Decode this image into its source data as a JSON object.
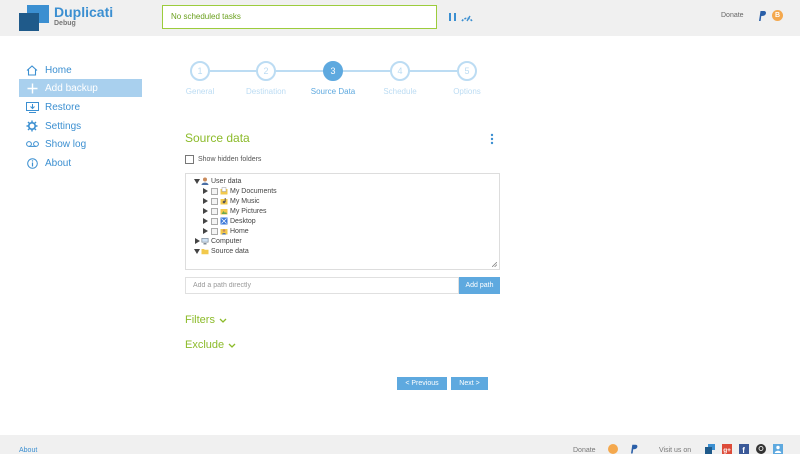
{
  "header": {
    "app_title": "Duplicati",
    "app_subtitle": "Debug",
    "status": "No scheduled tasks",
    "donate_label": "Donate"
  },
  "sidebar": {
    "items": [
      {
        "label": "Home",
        "icon": "home-icon"
      },
      {
        "label": "Add backup",
        "icon": "plus-icon",
        "active": true
      },
      {
        "label": "Restore",
        "icon": "restore-icon"
      },
      {
        "label": "Settings",
        "icon": "gear-icon"
      },
      {
        "label": "Show log",
        "icon": "log-icon"
      },
      {
        "label": "About",
        "icon": "info-icon"
      }
    ]
  },
  "wizard": {
    "steps": [
      {
        "number": "1",
        "label": "General"
      },
      {
        "number": "2",
        "label": "Destination"
      },
      {
        "number": "3",
        "label": "Source Data",
        "active": true
      },
      {
        "number": "4",
        "label": "Schedule"
      },
      {
        "number": "5",
        "label": "Options"
      }
    ]
  },
  "source": {
    "title": "Source data",
    "show_hidden_label": "Show hidden folders",
    "tree": [
      {
        "label": "User data",
        "level": 0,
        "expanded": true,
        "checkbox": false,
        "icon": "user-icon"
      },
      {
        "label": "My Documents",
        "level": 1,
        "expanded": false,
        "checkbox": true,
        "icon": "documents-icon"
      },
      {
        "label": "My Music",
        "level": 1,
        "expanded": false,
        "checkbox": true,
        "icon": "music-icon"
      },
      {
        "label": "My Pictures",
        "level": 1,
        "expanded": false,
        "checkbox": true,
        "icon": "pictures-icon"
      },
      {
        "label": "Desktop",
        "level": 1,
        "expanded": false,
        "checkbox": true,
        "icon": "desktop-icon"
      },
      {
        "label": "Home",
        "level": 1,
        "expanded": false,
        "checkbox": true,
        "icon": "home-folder-icon"
      },
      {
        "label": "Computer",
        "level": 0,
        "expanded": false,
        "checkbox": false,
        "icon": "computer-icon"
      },
      {
        "label": "Source data",
        "level": 0,
        "expanded": true,
        "checkbox": false,
        "icon": "folder-icon"
      }
    ],
    "path_placeholder": "Add a path directly",
    "add_path_label": "Add path",
    "filters_label": "Filters",
    "exclude_label": "Exclude"
  },
  "buttons": {
    "previous": "< Previous",
    "next": "Next >"
  },
  "footer": {
    "about": "About",
    "donate": "Donate",
    "visit_us": "Visit us on"
  },
  "colors": {
    "accent_blue": "#5ea9df",
    "accent_green": "#8cbb2a",
    "header_bg": "#f0f0f0"
  }
}
